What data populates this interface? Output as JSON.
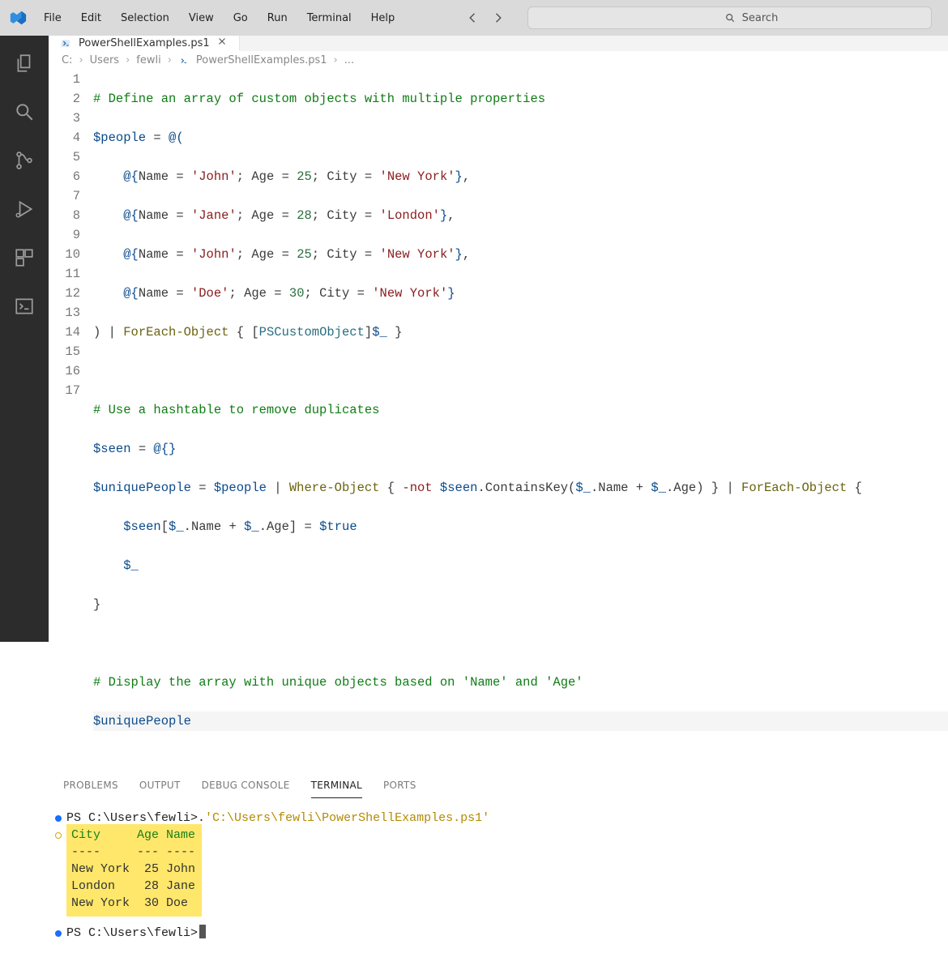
{
  "menu": {
    "file": "File",
    "edit": "Edit",
    "selection": "Selection",
    "view": "View",
    "go": "Go",
    "run": "Run",
    "terminal": "Terminal",
    "help": "Help"
  },
  "search_placeholder": "Search",
  "activity_icons": [
    "explorer",
    "search",
    "source-control",
    "run-debug",
    "extensions",
    "terminal"
  ],
  "tab": {
    "label": "PowerShellExamples.ps1"
  },
  "breadcrumbs": {
    "c": "C:",
    "users": "Users",
    "user": "fewli",
    "file": "PowerShellExamples.ps1",
    "dots": "..."
  },
  "line_numbers": [
    "1",
    "2",
    "3",
    "4",
    "5",
    "6",
    "7",
    "8",
    "9",
    "10",
    "11",
    "12",
    "13",
    "14",
    "15",
    "16",
    "17"
  ],
  "code": {
    "l1_comment": "# Define an array of custom objects with multiple properties",
    "l2_var": "$people",
    "l2_eq": " = ",
    "l2_open": "@(",
    "name_key": "Name",
    "age_key": "Age",
    "city_key": "City",
    "r1_name": "'John'",
    "r1_age": "25",
    "r1_city": "'New York'",
    "r2_name": "'Jane'",
    "r2_age": "28",
    "r2_city": "'London'",
    "r3_name": "'John'",
    "r3_age": "25",
    "r3_city": "'New York'",
    "r4_name": "'Doe'",
    "r4_age": "30",
    "r4_city": "'New York'",
    "close_paren": ")",
    "pipe": " | ",
    "foreach": "ForEach-Object",
    "brace_open": " { ",
    "cast_open": "[",
    "pscustom": "PSCustomObject",
    "cast_close": "]",
    "dund": "$_",
    "brace_close": " }",
    "l9_comment": "# Use a hashtable to remove duplicates",
    "seen": "$seen",
    "empty_ht": "@{}",
    "unique": "$uniquePeople",
    "where": "Where-Object",
    "not": "-not",
    "contains": ".ContainsKey(",
    "dot_name": ".Name",
    "plus": " + ",
    "dot_age": ".Age",
    "close_call": ")",
    "trailing_open": " {",
    "seen_index_open": "[",
    "seen_index_close": "]",
    "true": "$true",
    "l16_comment": "# Display the array with unique objects based on 'Name' and 'Age'",
    "l17_var": "$uniquePeople",
    "eq": " = "
  },
  "panel": {
    "problems": "PROBLEMS",
    "output": "OUTPUT",
    "debug": "DEBUG CONSOLE",
    "terminal": "TERMINAL",
    "ports": "PORTS"
  },
  "terminal": {
    "prompt1_pre": "PS C:\\Users\\fewli>",
    "prompt1_cmd_dot": " . ",
    "prompt1_cmd_path": "'C:\\Users\\fewli\\PowerShellExamples.ps1'",
    "hdr": "City     Age Name",
    "sep": "----     --- ----",
    "row1": "New York  25 John",
    "row2": "London    28 Jane",
    "row3": "New York  30 Doe",
    "prompt2": "PS C:\\Users\\fewli>"
  }
}
